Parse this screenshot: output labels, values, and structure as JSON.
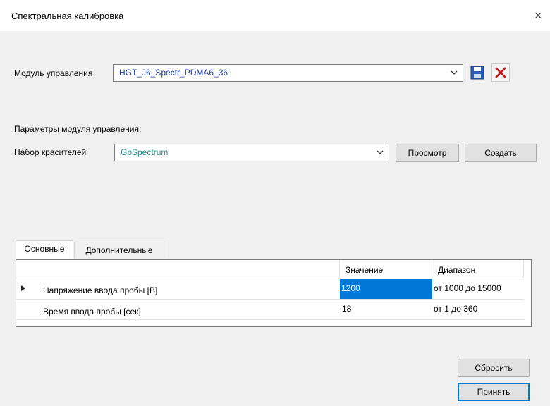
{
  "window": {
    "title": "Спектральная калибровка",
    "close_label": "×"
  },
  "module": {
    "label": "Модуль управления",
    "value": "HGT_J6_Spectr_PDMA6_36",
    "value_color": "#1f3aa8"
  },
  "params": {
    "heading": "Параметры модуля управления:",
    "dyes_label": "Набор красителей",
    "dyes_value": "GpSpectrum",
    "dyes_color": "#1c8a8a",
    "view_button": "Просмотр",
    "create_button": "Создать"
  },
  "tabs": [
    {
      "label": "Основные",
      "active": true
    },
    {
      "label": "Дополнительные",
      "active": false
    }
  ],
  "grid": {
    "columns": [
      "",
      "Значение",
      "Диапазон"
    ],
    "rows": [
      {
        "name": "Напряжение ввода пробы [В]",
        "value": "1200",
        "range": "от 1000 до 15000",
        "selected": true
      },
      {
        "name": "Время ввода пробы [сек]",
        "value": "18",
        "range": "от 1 до 360",
        "selected": false
      }
    ]
  },
  "footer": {
    "reset_button": "Сбросить",
    "apply_button": "Принять"
  },
  "colors": {
    "selection": "#0078d7",
    "accent": "#0078d7"
  }
}
